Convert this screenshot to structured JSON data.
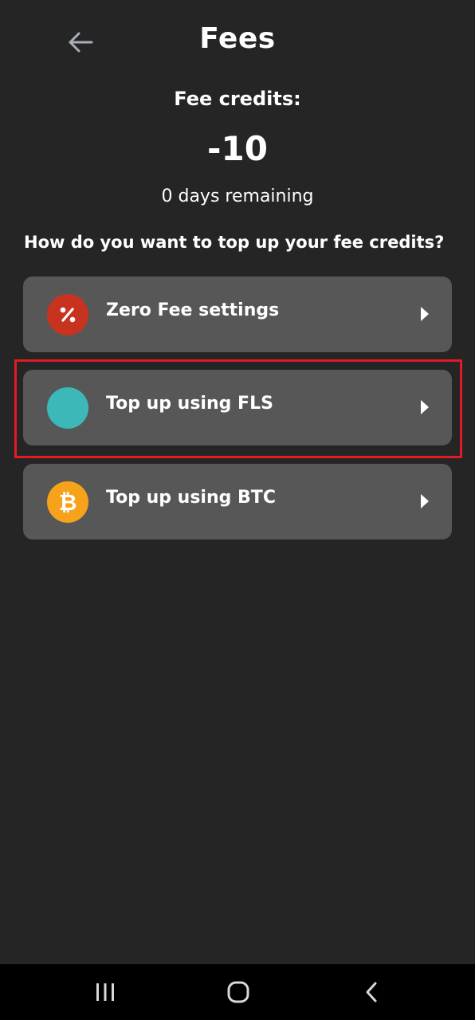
{
  "header": {
    "title": "Fees",
    "back_icon": "arrow-left-icon"
  },
  "credits": {
    "label": "Fee credits:",
    "value": "-10",
    "days_remaining": "0 days remaining"
  },
  "question": "How do you want to top up your fee credits?",
  "options": [
    {
      "label": "Zero Fee settings",
      "icon": "percent-icon",
      "icon_color": "#c8331f"
    },
    {
      "label": "Top up using FLS",
      "icon": "fls-coin-icon",
      "icon_color": "#3db8b8"
    },
    {
      "label": "Top up using BTC",
      "icon": "bitcoin-icon",
      "icon_color": "#f7a21b"
    }
  ],
  "highlight_color": "#e01b24",
  "navbar": {
    "buttons": [
      "recent-apps-icon",
      "home-icon",
      "back-icon"
    ]
  }
}
